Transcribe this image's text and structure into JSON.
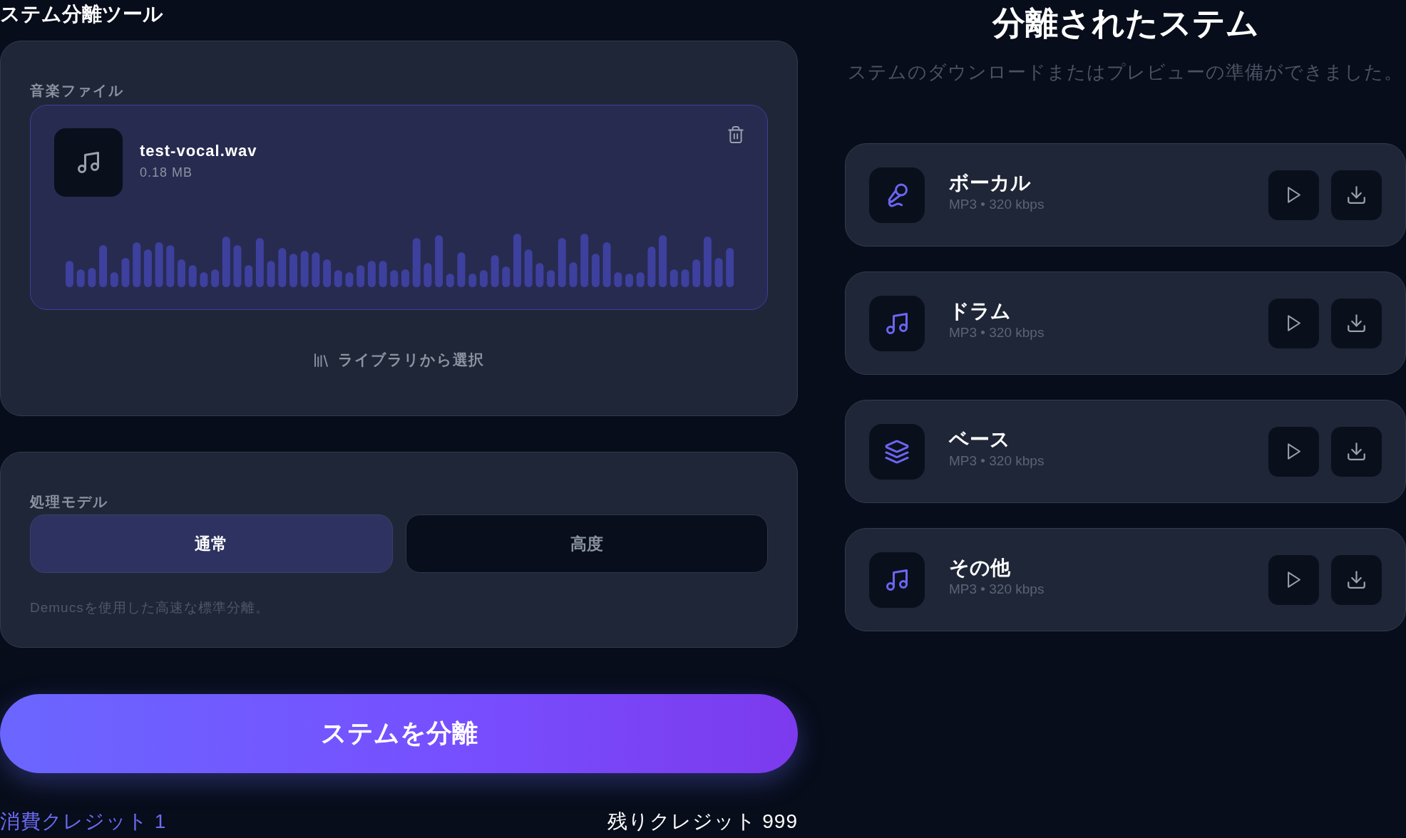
{
  "tool": {
    "title": "ステム分離ツール"
  },
  "file_panel": {
    "label": "音楽ファイル",
    "file": {
      "name": "test-vocal.wav",
      "size": "0.18 MB"
    },
    "library_button": "ライブラリから選択"
  },
  "model_panel": {
    "label": "処理モデル",
    "options": [
      {
        "label": "通常",
        "selected": true
      },
      {
        "label": "高度",
        "selected": false
      }
    ],
    "description": "Demucsを使用した高速な標準分離。"
  },
  "separate_button": "ステムを分離",
  "credits": {
    "cost": "消費クレジット 1",
    "remaining": "残りクレジット 999"
  },
  "results": {
    "title": "分離されたステム",
    "subtitle": "ステムのダウンロードまたはプレビューの準備ができました。",
    "stems": [
      {
        "kind": "vocals",
        "name": "ボーカル",
        "format": "MP3 • 320 kbps"
      },
      {
        "kind": "drums",
        "name": "ドラム",
        "format": "MP3 • 320 kbps"
      },
      {
        "kind": "bass",
        "name": "ベース",
        "format": "MP3 • 320 kbps"
      },
      {
        "kind": "other",
        "name": "その他",
        "format": "MP3 • 320 kbps"
      }
    ]
  }
}
